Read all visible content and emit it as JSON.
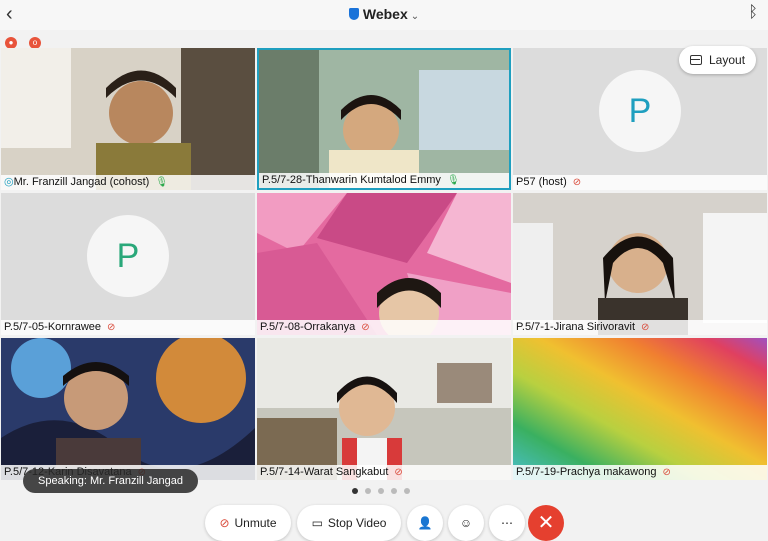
{
  "header": {
    "title": "Webex",
    "back_icon": "chevron-left-icon",
    "bt_icon": "bluetooth-icon"
  },
  "layout_button": "Layout",
  "tiles": [
    {
      "name": "Mr. Franzill Jangad (cohost)",
      "mic": "on"
    },
    {
      "name": "P.5/7-28-Thanwarin Kumtalod Emmy",
      "mic": "on"
    },
    {
      "name": "P57 (host)",
      "mic": "muted",
      "avatar": "P"
    },
    {
      "name": "P.5/7-05-Kornrawee",
      "mic": "muted",
      "avatar": "P"
    },
    {
      "name": "P.5/7-08-Orrakanya",
      "mic": "muted"
    },
    {
      "name": "P.5/7-1-Jirana Sirivoravit",
      "mic": "muted"
    },
    {
      "name": "P.5/7-12-Karin Disavatana",
      "mic": "muted"
    },
    {
      "name": "P.5/7-14-Warat Sangkabut",
      "mic": "muted"
    },
    {
      "name": "P.5/7-19-Prachya makawong",
      "mic": "muted"
    }
  ],
  "speaking": "Speaking: Mr. Franzill Jangad",
  "controls": {
    "unmute": "Unmute",
    "stop_video": "Stop Video"
  },
  "colors": {
    "accent": "#1a73d9",
    "end": "#e5402f",
    "muted": "#d94a3a",
    "unmuted": "#2aa84a"
  }
}
